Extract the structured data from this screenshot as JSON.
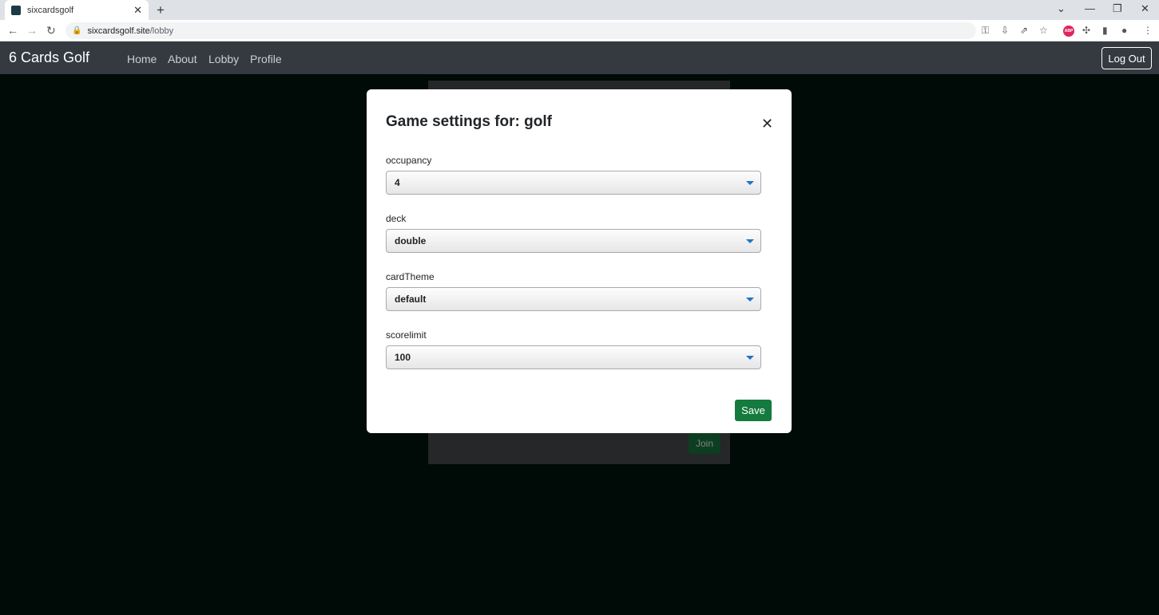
{
  "browser": {
    "tab_title": "sixcardsgolf",
    "url_host": "sixcardsgolf.site",
    "url_path": "/lobby"
  },
  "site": {
    "brand": "6 Cards Golf",
    "nav": [
      "Home",
      "About",
      "Lobby",
      "Profile"
    ],
    "logout_label": "Log Out"
  },
  "lobby": {
    "join_label": "Join"
  },
  "modal": {
    "title": "Game settings for: golf",
    "fields": [
      {
        "label": "occupancy",
        "value": "4"
      },
      {
        "label": "deck",
        "value": "double"
      },
      {
        "label": "cardTheme",
        "value": "default"
      },
      {
        "label": "scorelimit",
        "value": "100"
      }
    ],
    "save_label": "Save"
  },
  "colors": {
    "page_bg": "#00150f",
    "navbar_bg": "#343a40",
    "save_green": "#157a3e",
    "caret_blue": "#1a76c9"
  }
}
